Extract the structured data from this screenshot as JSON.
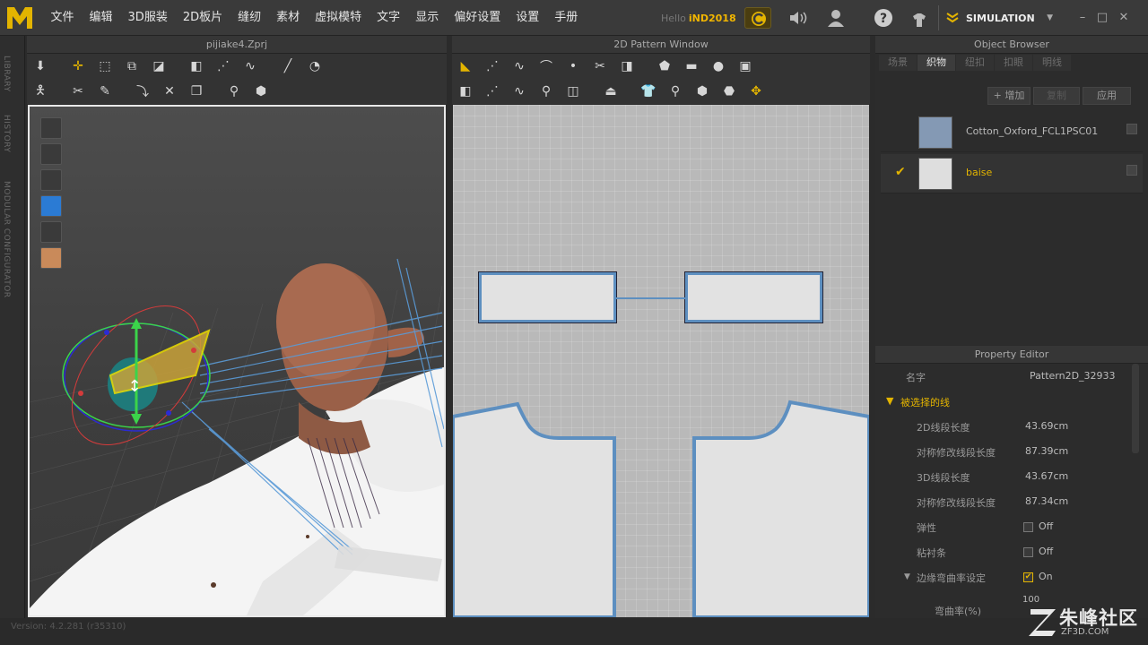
{
  "menubar": {
    "items": [
      "文件",
      "编辑",
      "3D服装",
      "2D板片",
      "缝纫",
      "素材",
      "虚拟模特",
      "文字",
      "显示",
      "偏好设置",
      "设置",
      "手册"
    ],
    "hello": "Hello",
    "user": "iND2018",
    "mode": "SIMULATION"
  },
  "sidebar": {
    "tabs": [
      "LIBRARY",
      "HISTORY",
      "MODULAR CONFIGURATOR"
    ]
  },
  "view3d": {
    "title": "pijiake4.Zprj"
  },
  "view2d": {
    "title": "2D Pattern Window"
  },
  "object_browser": {
    "title": "Object Browser",
    "tabs": [
      "场景",
      "织物",
      "纽扣",
      "扣眼",
      "明线"
    ],
    "active_tab": "织物",
    "add_label": "+ 增加",
    "copy_label": "复制",
    "apply_label": "应用",
    "fabrics": [
      {
        "name": "Cotton_Oxford_FCL1PSC01",
        "color": "#8499b4",
        "checked": false
      },
      {
        "name": "baise",
        "color": "#dedede",
        "checked": true
      }
    ]
  },
  "property_editor": {
    "title": "Property Editor",
    "name_label": "名字",
    "name_value": "Pattern2D_32933",
    "section": "被选择的线",
    "rows": [
      {
        "label": "2D线段长度",
        "value": "43.69cm"
      },
      {
        "label": "对称修改线段长度",
        "value": "87.39cm"
      },
      {
        "label": "3D线段长度",
        "value": "43.67cm"
      },
      {
        "label": "对称修改线段长度",
        "value": "87.34cm"
      }
    ],
    "toggles": [
      {
        "label": "弹性",
        "value": "Off",
        "checked": false
      },
      {
        "label": "粘衬条",
        "value": "Off",
        "checked": false
      },
      {
        "label": "边缘弯曲率设定",
        "value": "On",
        "checked": true
      }
    ],
    "curvature_label": "弯曲率(%)",
    "curvature_value": "100"
  },
  "status": {
    "version": "Version: 4.2.281 (r35310)"
  },
  "watermark": {
    "brand": "朱峰社区",
    "site": "ZF3D.COM"
  },
  "colors": {
    "accent": "#e3b400",
    "selection_blue": "#5d8fc0"
  }
}
